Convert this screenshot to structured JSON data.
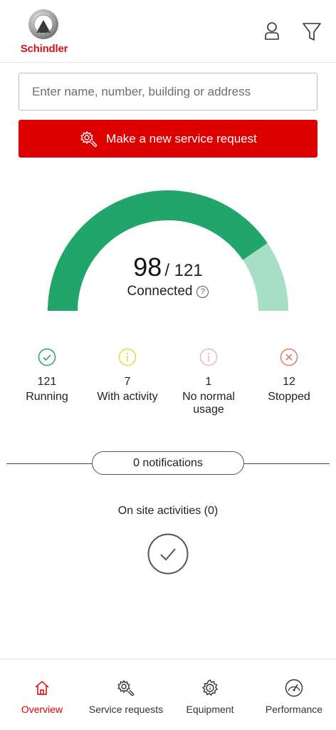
{
  "header": {
    "brand": "Schindler",
    "user_icon": "user-icon",
    "filter_icon": "filter-icon"
  },
  "search": {
    "placeholder": "Enter name, number, building or address",
    "value": ""
  },
  "service_request_button": {
    "label": "Make a new service request",
    "icon": "service-gear-icon",
    "color": "#dc0000"
  },
  "gauge": {
    "connected": "98",
    "total": "/ 121",
    "label": "Connected",
    "connected_fraction": 0.81,
    "colors": {
      "connected": "#22a56b",
      "remaining": "#a6dfc3"
    }
  },
  "status": [
    {
      "count": "121",
      "label": "Running",
      "icon": "check-circle-icon",
      "color": "#22a56b"
    },
    {
      "count": "7",
      "label": "With activity",
      "icon": "info-circle-icon",
      "color": "#e8d83a"
    },
    {
      "count": "1",
      "label": "No normal usage",
      "icon": "info-circle-icon",
      "color": "#f0b8b0"
    },
    {
      "count": "12",
      "label": "Stopped",
      "icon": "x-circle-icon",
      "color": "#e07a66"
    }
  ],
  "notifications": {
    "label": "0 notifications"
  },
  "onsite": {
    "title": "On site activities (0)",
    "icon": "check-circle-icon"
  },
  "nav": {
    "items": [
      {
        "label": "Overview",
        "icon": "home-icon",
        "active": true
      },
      {
        "label": "Service requests",
        "icon": "service-gear-icon",
        "active": false
      },
      {
        "label": "Equipment",
        "icon": "equipment-gear-icon",
        "active": false
      },
      {
        "label": "Performance",
        "icon": "speedometer-icon",
        "active": false
      }
    ],
    "active_color": "#dc0000"
  }
}
